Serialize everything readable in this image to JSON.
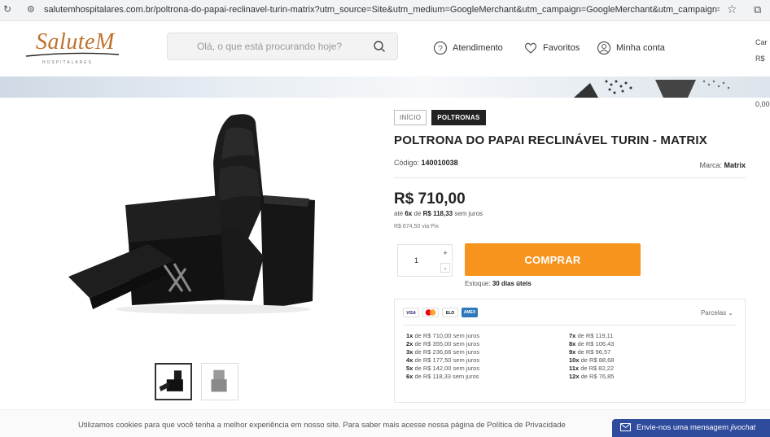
{
  "browser": {
    "url": "salutemhospitalares.com.br/poltrona-do-papai-reclinavel-turin-matrix?utm_source=Site&utm_medium=GoogleMerchant&utm_campaign=GoogleMerchant&utm_campaign=GERAL-PMAX&ga..."
  },
  "header": {
    "logo_text": "SaluteM",
    "logo_tagline": "HOSPITALARES",
    "search_placeholder": "Olá, o que está procurando hoje?",
    "nav": [
      {
        "label": "Atendimento",
        "icon": "help-circle-icon"
      },
      {
        "label": "Favoritos",
        "icon": "heart-icon"
      },
      {
        "label": "Minha conta",
        "icon": "user-icon"
      }
    ],
    "cart_peek": [
      "Car",
      "R$"
    ]
  },
  "banner": {
    "right_peek": "0,00"
  },
  "breadcrumbs": [
    "INÍCIO",
    "POLTRONAS"
  ],
  "product": {
    "title": "POLTRONA DO PAPAI RECLINÁVEL TURIN - MATRIX",
    "code_label": "Código:",
    "code": "140010038",
    "brand_label": "Marca:",
    "brand": "Matrix",
    "price": "R$ 710,00",
    "installment_prefix": "até",
    "installment_count": "6x",
    "installment_mid": "de",
    "installment_value": "R$ 118,33",
    "installment_suffix": "sem juros",
    "pix_text": "R$ 674,50 via Pix",
    "quantity": "1",
    "plus": "+",
    "minus": "-",
    "buy_label": "COMPRAR",
    "stock_label": "Estoque:",
    "stock_value": "30 dias úteis"
  },
  "payment": {
    "cards": [
      "VISA",
      "mastercard",
      "ELO",
      "AMEX"
    ],
    "parcelas_label": "Parcelas",
    "left": [
      {
        "n": "1x",
        "text": "de R$ 710,00 sem juros"
      },
      {
        "n": "2x",
        "text": "de R$ 355,00 sem juros"
      },
      {
        "n": "3x",
        "text": "de R$ 236,66 sem juros"
      },
      {
        "n": "4x",
        "text": "de R$ 177,50 sem juros"
      },
      {
        "n": "5x",
        "text": "de R$ 142,00 sem juros"
      },
      {
        "n": "6x",
        "text": "de R$ 118,33 sem juros"
      }
    ],
    "right": [
      {
        "n": "7x",
        "text": "de R$ 119,11"
      },
      {
        "n": "8x",
        "text": "de R$ 106,43"
      },
      {
        "n": "9x",
        "text": "de R$ 96,57"
      },
      {
        "n": "10x",
        "text": "de R$ 88,68"
      },
      {
        "n": "11x",
        "text": "de R$ 82,22"
      },
      {
        "n": "12x",
        "text": "de R$ 76,85"
      }
    ]
  },
  "cookie": {
    "text": "Utilizamos cookies para que você tenha a melhor experiência em nosso site. Para saber mais acesse nossa página de Política de Privacidade"
  },
  "chat": {
    "label": "Envie-nos uma mensagem",
    "brand": "jivochat"
  },
  "colors": {
    "accent": "#f7941d",
    "logo": "#c0702a",
    "chat": "#2f4b9c"
  }
}
